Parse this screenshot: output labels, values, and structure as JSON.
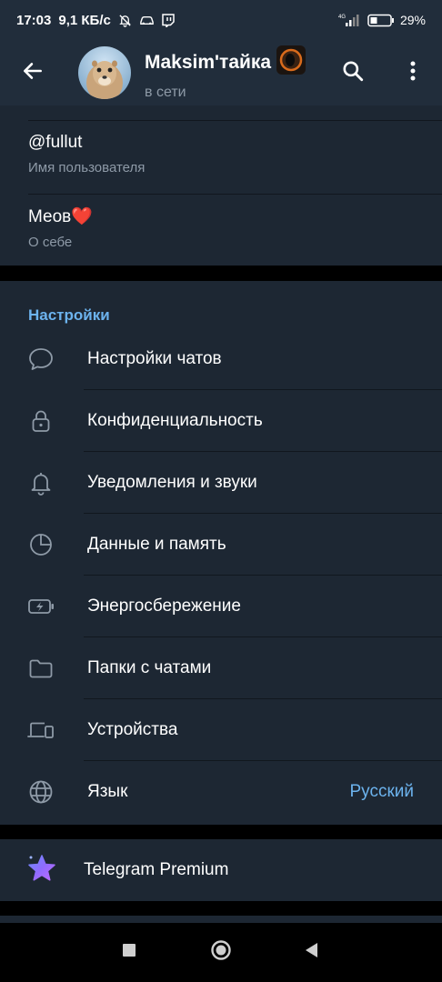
{
  "status_bar": {
    "time": "17:03",
    "speed": "9,1 КБ/с",
    "battery": "29%",
    "network": "4G"
  },
  "header": {
    "title": "Maksim'тайка",
    "subtitle": "в сети"
  },
  "profile": {
    "username": "@fullut",
    "username_label": "Имя пользователя",
    "bio": "Меов❤️",
    "bio_label": "О себе"
  },
  "settings": {
    "title": "Настройки",
    "items": [
      {
        "label": "Настройки чатов",
        "icon": "chat-bubble-icon"
      },
      {
        "label": "Конфиденциальность",
        "icon": "lock-icon"
      },
      {
        "label": "Уведомления и звуки",
        "icon": "bell-icon"
      },
      {
        "label": "Данные и память",
        "icon": "pie-chart-icon"
      },
      {
        "label": "Энергосбережение",
        "icon": "battery-bolt-icon"
      },
      {
        "label": "Папки с чатами",
        "icon": "folder-icon"
      },
      {
        "label": "Устройства",
        "icon": "devices-icon"
      },
      {
        "label": "Язык",
        "icon": "globe-icon",
        "value": "Русский"
      }
    ]
  },
  "premium": {
    "label": "Telegram Premium"
  },
  "colors": {
    "accent": "#6cb3ee",
    "background": "#1d2733",
    "header": "#212d3b",
    "secondary_text": "#8e9aa7"
  }
}
